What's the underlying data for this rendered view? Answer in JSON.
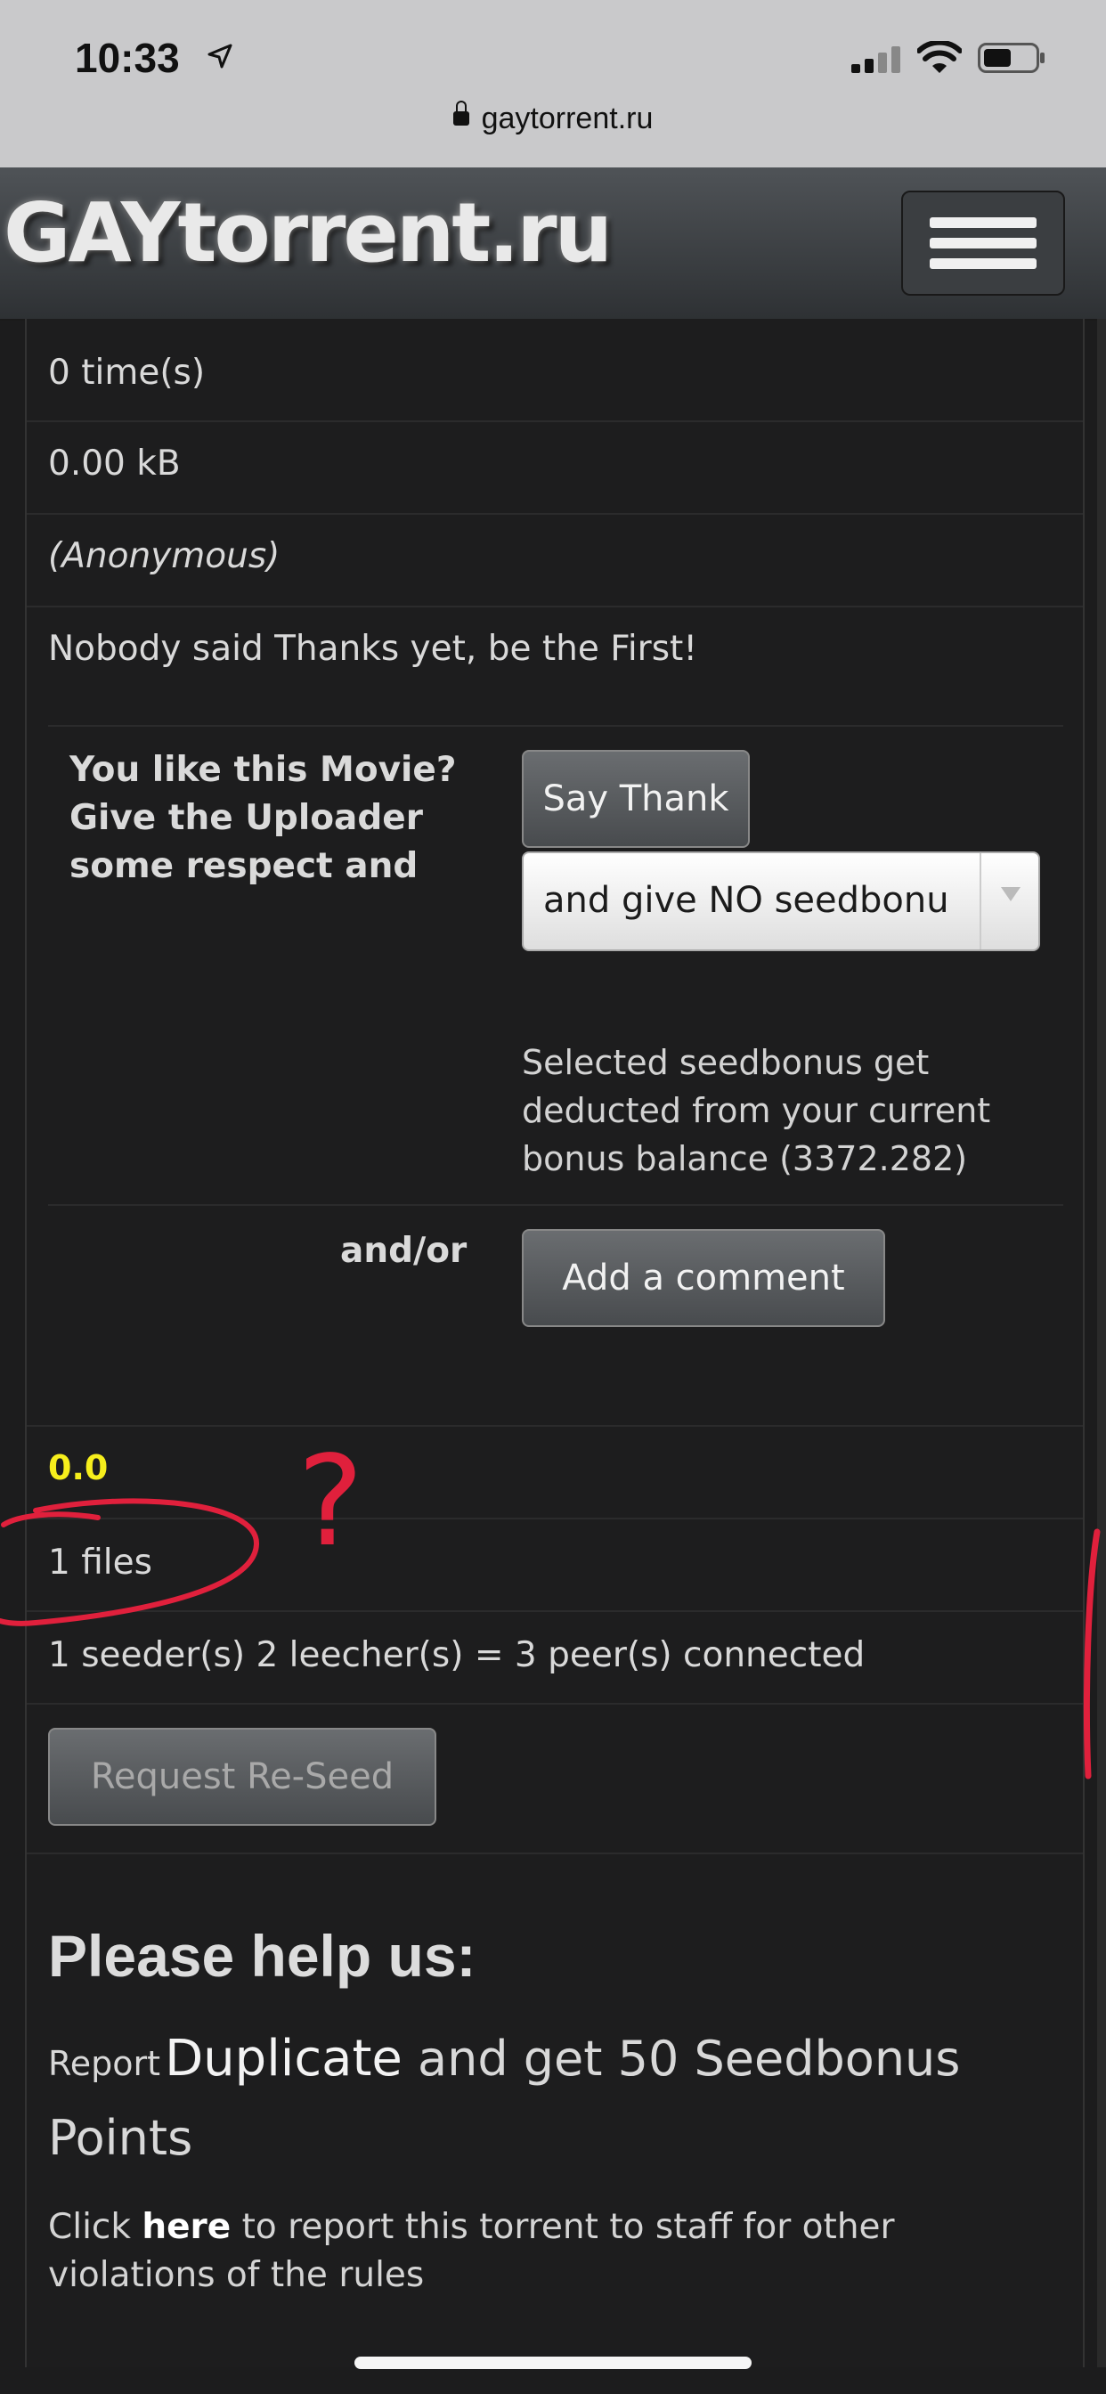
{
  "status_bar": {
    "time": "10:33"
  },
  "browser": {
    "url": "gaytorrent.ru"
  },
  "header": {
    "logo": "GAYtorrent.ru"
  },
  "details": {
    "snatched": "0 time(s)",
    "size": "0.00 kB",
    "uploader": "(Anonymous)",
    "thanks_status": "Nobody said Thanks yet, be the First!"
  },
  "thanks_form": {
    "label": "You like this Movie? Give the Uploader some respect and",
    "say_thanks_label": "Say Thank You!",
    "seedbonus_selected": "and give NO seedbonu",
    "seedbonus_note": "Selected seedbonus get deducted from your current bonus balance (3372.282)",
    "andor_label": "and/or",
    "add_comment_label": "Add a comment"
  },
  "stats": {
    "rating": "0.0",
    "files": "1 files",
    "peers": "1 seeder(s) 2 leecher(s) = 3 peer(s) connected",
    "reseed_label": "Request Re-Seed"
  },
  "help": {
    "title": "Please help us:",
    "report_prefix": "Report",
    "duplicate_link": "Duplicate",
    "report_suffix": " and get 50 Seedbonus Points",
    "click_prefix": "Click ",
    "here_link": "here",
    "click_suffix": " to report this torrent to staff for other violations of the rules"
  },
  "colors": {
    "rating": "#f6ee1c",
    "annotation": "#e0203c"
  },
  "annotation": {
    "mark": "?"
  }
}
